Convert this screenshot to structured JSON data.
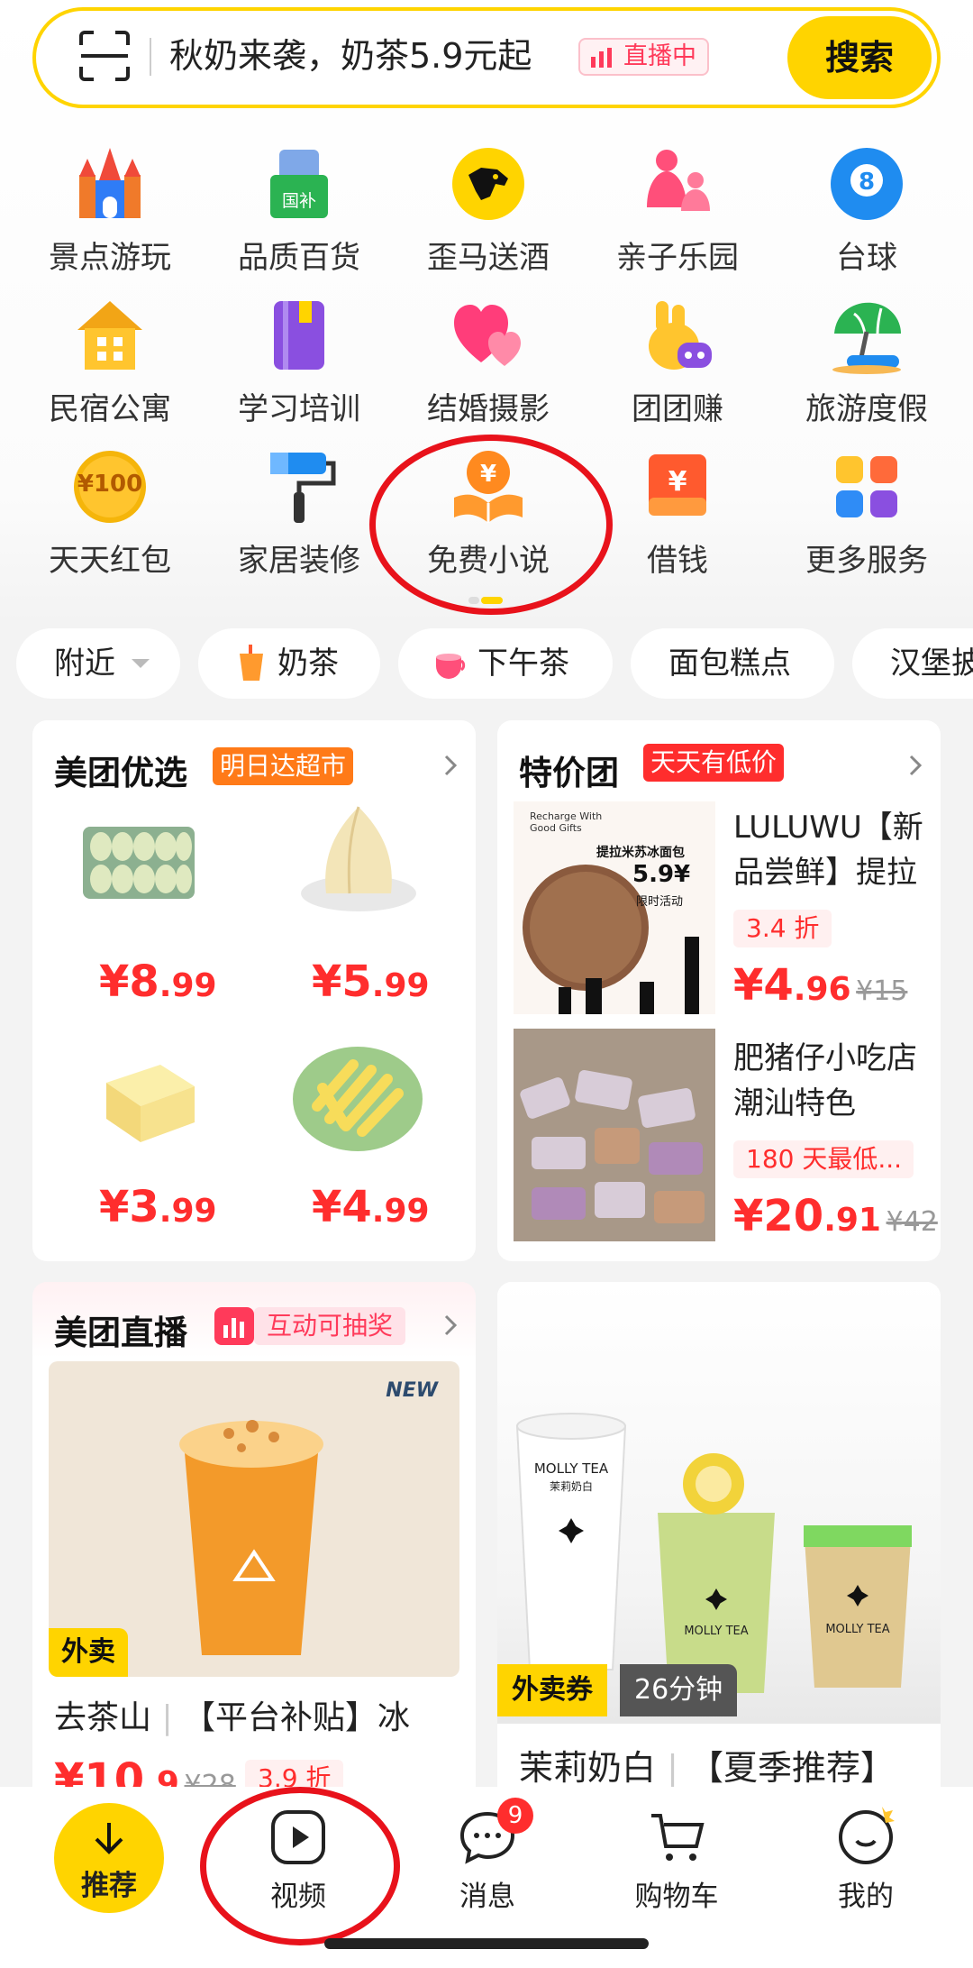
{
  "search": {
    "text": "秋奶来袭，奶茶5.9元起",
    "live_badge": "直播中",
    "button": "搜索"
  },
  "services": [
    {
      "label": "景点游玩",
      "icon": "castle-icon"
    },
    {
      "label": "品质百货",
      "icon": "shopping-bag-icon",
      "badge": "国补"
    },
    {
      "label": "歪马送酒",
      "icon": "horse-icon"
    },
    {
      "label": "亲子乐园",
      "icon": "parent-child-icon"
    },
    {
      "label": "台球",
      "icon": "billiard-ball-icon"
    },
    {
      "label": "民宿公寓",
      "icon": "house-icon"
    },
    {
      "label": "学习培训",
      "icon": "book-icon"
    },
    {
      "label": "结婚摄影",
      "icon": "hearts-icon"
    },
    {
      "label": "团团赚",
      "icon": "kangaroo-icon"
    },
    {
      "label": "旅游度假",
      "icon": "beach-umbrella-icon"
    },
    {
      "label": "天天红包",
      "icon": "coin-icon",
      "badge": "¥100"
    },
    {
      "label": "家居装修",
      "icon": "paint-roller-icon"
    },
    {
      "label": "免费小说",
      "icon": "open-book-coin-icon"
    },
    {
      "label": "借钱",
      "icon": "wallet-icon"
    },
    {
      "label": "更多服务",
      "icon": "grid-icon"
    }
  ],
  "chips": [
    "附近",
    "奶茶",
    "下午茶",
    "面包糕点",
    "汉堡披"
  ],
  "youxuan": {
    "title": "美团优选",
    "tag": "明日达超市",
    "items": [
      {
        "int": "¥8",
        "dec": ".99"
      },
      {
        "int": "¥5",
        "dec": ".99"
      },
      {
        "int": "¥3",
        "dec": ".99"
      },
      {
        "int": "¥4",
        "dec": ".99"
      }
    ]
  },
  "tejia": {
    "title": "特价团",
    "tag": "天天有低价",
    "items": [
      {
        "desc": "LULUWU【新品尝鲜】提拉",
        "discount": "3.4 折",
        "int": "¥4",
        "dec": ".96",
        "orig": "¥15",
        "img_text_1": "Recharge With Good Gifts",
        "img_text_2": "提拉米苏冰面包",
        "img_text_3": "5.9¥",
        "img_text_4": "限时活动"
      },
      {
        "desc": "肥猪仔小吃店 潮汕特色",
        "discount": "180 天最低...",
        "int": "¥20",
        "dec": ".91",
        "orig": "¥42"
      }
    ]
  },
  "live": {
    "title": "美团直播",
    "tag": "互动可抽奖",
    "image_badge": "外卖",
    "new_badge": "NEW",
    "desc": "去茶山",
    "desc2": "【平台补贴】冰",
    "int": "¥10",
    "dec": ".9",
    "orig": "¥28",
    "discount": "3.9 折"
  },
  "molly": {
    "badge1": "外卖券",
    "badge2": "26分钟",
    "desc": "茉莉奶白",
    "desc2": "【夏季推荐】",
    "brand": "MOLLY TEA",
    "brand_cn": "茉莉奶白"
  },
  "nav": {
    "recommend": "推荐",
    "video": "视频",
    "messages": "消息",
    "messages_badge": "9",
    "cart": "购物车",
    "me": "我的"
  },
  "colors": {
    "brand_yellow": "#ffd400",
    "price_red": "#ff2d2d",
    "annotation_red": "#e8121b"
  }
}
